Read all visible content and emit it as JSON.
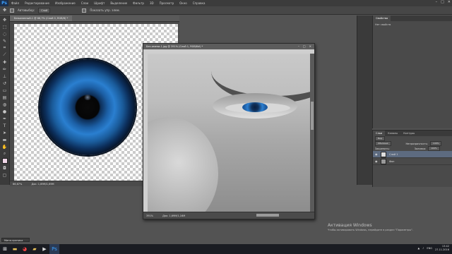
{
  "app": {
    "logo": "Ps"
  },
  "menu": [
    "Файл",
    "Редактирование",
    "Изображение",
    "Слои",
    "Шрифт",
    "Выделение",
    "Фильтр",
    "3D",
    "Просмотр",
    "Окно",
    "Справка"
  ],
  "window_controls": [
    "–",
    "□",
    "✕"
  ],
  "options_bar": {
    "mode_label": "Автовыбор:",
    "mode_value": "Слой",
    "transform_label": "Показать упр. элем."
  },
  "doc1": {
    "tab": "Безымянный-1 @ 66,7% (Слой 0, RGB/8) *",
    "zoom": "66,67%",
    "doc_info": "Док: 1,69М/1,69М"
  },
  "doc2": {
    "title": "Без-имени-1.jpg @ 391% (Слой 1, RGB/8#) *",
    "zoom": "391%",
    "doc_info": "Док: 1,69М/1,16М",
    "controls": [
      "–",
      "□",
      "✕"
    ]
  },
  "properties_panel": {
    "tabs": [
      "Свойства"
    ],
    "empty_text": "Нет свойств"
  },
  "layers_panel": {
    "tabs": [
      "Слои",
      "Каналы",
      "Контуры"
    ],
    "kind": "Вид",
    "blend_mode": "Обычные",
    "opacity_label": "Непрозрачность:",
    "opacity_value": "100%",
    "lock_label": "Закрепить:",
    "fill_label": "Заливка:",
    "fill_value": "100%",
    "layers": [
      {
        "name": "Слой 1",
        "selected": true
      },
      {
        "name": "Фон",
        "selected": false
      }
    ]
  },
  "mini_bridge": {
    "label": "Мини-хроника"
  },
  "watermark": {
    "title": "Активация Windows",
    "subtitle": "Чтобы активировать Windows, перейдите в раздел \"Параметры\"."
  },
  "taskbar": {
    "lang": "ENG",
    "time": "13:42",
    "date": "27.11.2016"
  }
}
